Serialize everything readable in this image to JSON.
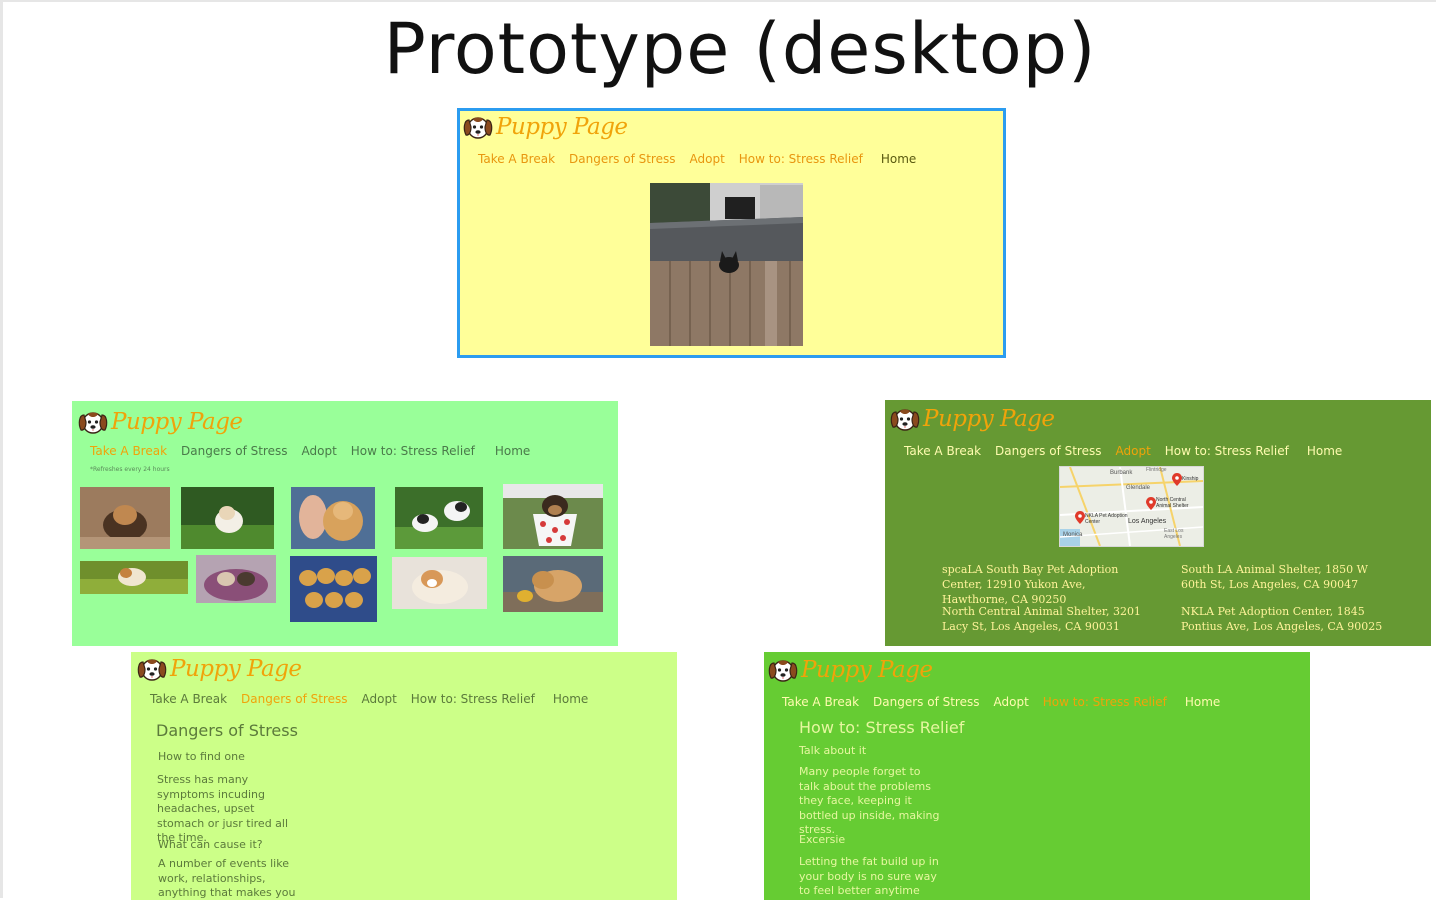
{
  "page_title": "Prototype (desktop)",
  "brand": "Puppy Page",
  "nav": [
    "Take A Break",
    "Dangers of Stress",
    "Adopt",
    "How to: Stress Relief",
    "Home"
  ],
  "take_a_break": {
    "refresh_note": "*Refreshes every 24 hours"
  },
  "adopt": {
    "map_labels": [
      "Burbank",
      "Glendale",
      "Kinship",
      "North Central Animal Shelter",
      "NKLA Pet Adoption Center",
      "Los Angeles",
      "Monica",
      "East Los Angeles",
      "Flintridge"
    ],
    "shelters": [
      "spcaLA South Bay Pet Adoption Center, 12910 Yukon Ave, Hawthorne, CA 90250",
      "South LA Animal Shelter, 1850 W 60th St, Los Angeles, CA 90047",
      "North Central Animal Shelter, 3201 Lacy St, Los Angeles, CA 90031",
      "NKLA Pet Adoption Center, 1845 Pontius Ave, Los Angeles, CA 90025"
    ]
  },
  "dangers": {
    "heading": "Dangers of Stress",
    "q1": "How to find one",
    "p1": "Stress has many symptoms incuding headaches, upset stomach or jusr tired all the time.",
    "q2": "What can cause it?",
    "p2": "A number of events like work, relationships, anything that makes you"
  },
  "relief": {
    "heading": "How to: Stress Relief",
    "s1": "Talk about it",
    "p1": "Many people forget to talk about the problems they face, keeping it bottled up inside, making stress.",
    "s2": "Excersie",
    "p2": "Letting the fat build up in your body is no sure way to feel better anytime soon."
  },
  "colors": {
    "frame_home": "#ffff99",
    "frame_home_border": "#2b9cf0",
    "frame_take_a_break": "#99ff99",
    "frame_adopt": "#669933",
    "frame_dangers": "#ccff88",
    "frame_relief": "#66cc33",
    "brand": "#f0a30a"
  },
  "icons": [
    "puppy-logo-icon",
    "map-pin-icon"
  ]
}
